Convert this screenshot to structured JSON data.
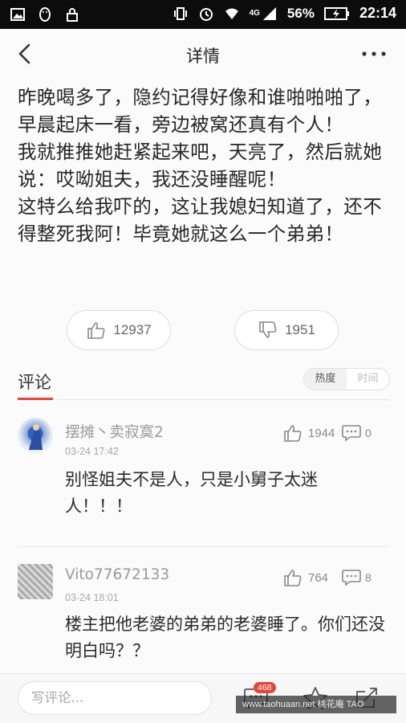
{
  "status_bar": {
    "network": "4G",
    "battery": "56%",
    "time": "22:14"
  },
  "header": {
    "title": "详情"
  },
  "article": {
    "lines": [
      "昨晚喝多了，隐约记得好像和谁啪啪啪了，早晨起床一看，旁边被窝还真有个人！",
      "我就推推她赶紧起来吧，天亮了，然后就她说：哎呦姐夫，我还没睡醒呢！",
      "这特么给我吓的，这让我媳妇知道了，还不得整死我阿！毕竟她就这么一个弟弟！"
    ]
  },
  "votes": {
    "up": "12937",
    "down": "1951"
  },
  "comments_section": {
    "title": "评论",
    "sort_hot": "热度",
    "sort_time": "时间"
  },
  "comments": [
    {
      "username": "摆摊丶卖寂寞2",
      "date": "03-24 17:42",
      "likes": "1944",
      "replies": "0",
      "text": "别怪姐夫不是人，只是小舅子太迷人！！！"
    },
    {
      "username": "Vito77672133",
      "date": "03-24 18:01",
      "likes": "764",
      "replies": "8",
      "text": "楼主把他老婆的弟弟的老婆睡了。你们还没明白吗？？"
    }
  ],
  "bottom_bar": {
    "input_placeholder": "写评论...",
    "comment_count": "468"
  },
  "watermark": "www.taohuaan.net  桃花庵  TAO",
  "colors": {
    "accent": "#e0473f",
    "text": "#262626",
    "muted": "#9a9a9a"
  }
}
